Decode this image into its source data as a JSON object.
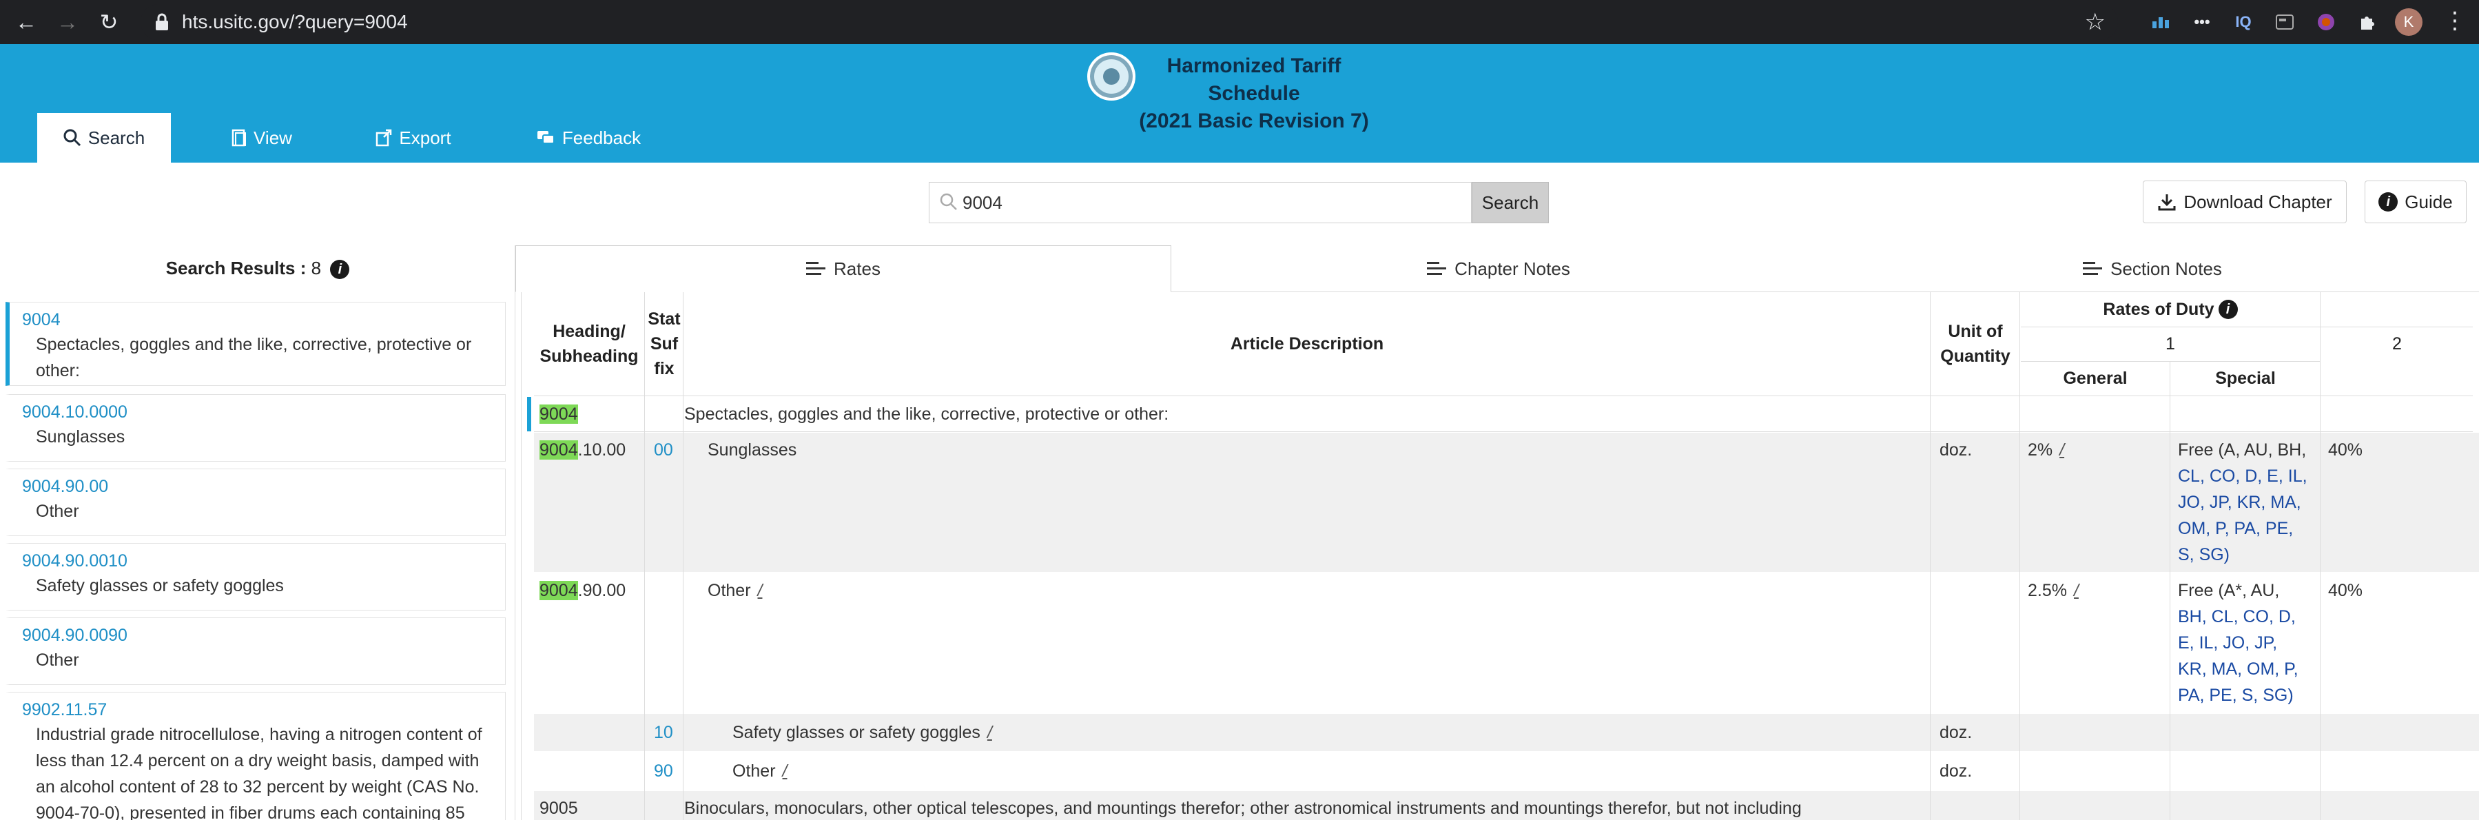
{
  "browser": {
    "url": "hts.usitc.gov/?query=9004",
    "extensions": [
      "IQ"
    ],
    "avatar_initial": "K"
  },
  "header": {
    "title_line1": "Harmonized Tariff Schedule",
    "title_line2": "(2021 Basic Revision 7)",
    "tabs": [
      {
        "label": "Search",
        "icon": "search-icon"
      },
      {
        "label": "View",
        "icon": "document-icon"
      },
      {
        "label": "Export",
        "icon": "export-icon"
      },
      {
        "label": "Feedback",
        "icon": "feedback-icon"
      }
    ]
  },
  "search": {
    "value": "9004",
    "button_label": "Search"
  },
  "toolbar": {
    "download_label": "Download Chapter",
    "guide_label": "Guide"
  },
  "sidebar": {
    "title": "Search Results :",
    "count": "8",
    "results": [
      {
        "code": "9004",
        "desc": "Spectacles, goggles and the like, corrective, protective or other:"
      },
      {
        "code": "9004.10.0000",
        "desc": "Sunglasses"
      },
      {
        "code": "9004.90.00",
        "desc": "Other"
      },
      {
        "code": "9004.90.0010",
        "desc": "Safety glasses or safety goggles"
      },
      {
        "code": "9004.90.0090",
        "desc": "Other"
      },
      {
        "code": "9902.11.57",
        "desc": "Industrial grade nitrocellulose, having a nitrogen content of less than 12.4 percent on a dry weight basis, damped with an alcohol content of 28 to 32 percent by weight (CAS No. 9004-70-0), presented in fiber drums each containing 85"
      }
    ]
  },
  "content_tabs": [
    "Rates",
    "Chapter Notes",
    "Section Notes"
  ],
  "table": {
    "headers": {
      "heading": "Heading/ Subheading",
      "stat": "Stat Suf fix",
      "desc": "Article Description",
      "unit": "Unit of Quantity",
      "rates": "Rates of Duty",
      "col1": "1",
      "general": "General",
      "special": "Special",
      "col2": "2"
    },
    "rows": [
      {
        "heading_hl": "9004",
        "heading_rest": "",
        "stat": "",
        "desc": "Spectacles, goggles and the like, corrective, protective or other:",
        "unit": "",
        "general": "",
        "special": "",
        "col2": ""
      },
      {
        "heading_hl": "9004",
        "heading_rest": ".10.00",
        "stat": "00",
        "desc": "Sunglasses",
        "unit": "doz.",
        "general": "2%",
        "special_lines": [
          "Free (A, AU, BH,",
          "CL, CO, D, E, IL,",
          "JO, JP, KR, MA,",
          "OM, P, PA, PE,",
          "S, SG)"
        ],
        "col2": "40%"
      },
      {
        "heading_hl": "9004",
        "heading_rest": ".90.00",
        "stat": "",
        "desc": "Other",
        "unit": "",
        "general": "2.5%",
        "special_lines": [
          "Free (A*, AU,",
          "BH, CL, CO, D,",
          "E, IL, JO, JP,",
          "KR, MA, OM, P,",
          "PA, PE, S, SG)"
        ],
        "col2": "40%"
      },
      {
        "heading_hl": "",
        "heading_rest": "",
        "stat": "10",
        "desc": "Safety glasses or safety goggles",
        "unit": "doz.",
        "general": "",
        "special": "",
        "col2": ""
      },
      {
        "heading_hl": "",
        "heading_rest": "",
        "stat": "90",
        "desc": "Other",
        "unit": "doz.",
        "general": "",
        "special": "",
        "col2": ""
      },
      {
        "heading_hl": "",
        "heading_rest": "9005",
        "stat": "",
        "desc": "Binoculars, monoculars, other optical telescopes, and mountings therefor; other astronomical instruments and mountings therefor, but not including",
        "unit": "",
        "general": "",
        "special": "",
        "col2": ""
      }
    ],
    "footnote_mark": "/"
  }
}
